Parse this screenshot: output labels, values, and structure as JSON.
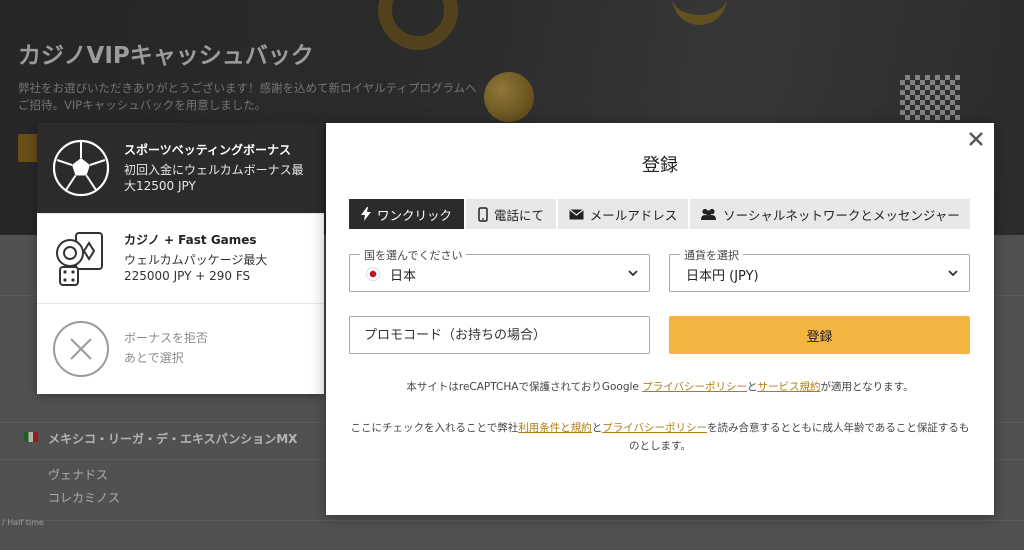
{
  "background": {
    "hero_title": "カジノVIPキャッシュバック",
    "hero_desc": "弊社をお選びいただきありがとうございます！感謝を込めて新ロイヤルティプログラムへご招待。VIPキャッシュバックを用意しました。",
    "league_name": "メキシコ・リーガ・デ・エキスパンションMX",
    "team_1": "ヴェナドス",
    "team_2": "コレカミノス",
    "half_time_label": "/ Half time"
  },
  "bonus_panel": {
    "items": [
      {
        "title": "スポーツベッティングボーナス",
        "desc": "初回入金にウェルカムボーナス最大12500 JPY",
        "icon": "soccer-ball-icon",
        "state": "selected"
      },
      {
        "title": "カジノ + Fast Games",
        "desc": "ウェルカムパッケージ最大225000 JPY + 290 FS",
        "icon": "casino-cards-icon",
        "state": "default"
      },
      {
        "title": "ボーナスを拒否",
        "desc": "あとで選択",
        "icon": "decline-x-icon",
        "state": "muted"
      }
    ]
  },
  "modal": {
    "title": "登録",
    "close_icon": "close-icon",
    "tabs": [
      {
        "label": "ワンクリック",
        "icon": "lightning-icon",
        "active": true
      },
      {
        "label": "電話にて",
        "icon": "phone-icon",
        "active": false
      },
      {
        "label": "メールアドレス",
        "icon": "envelope-icon",
        "active": false
      },
      {
        "label": "ソーシャルネットワークとメッセンジャー",
        "icon": "users-icon",
        "active": false
      }
    ],
    "country": {
      "label": "国を選んでください",
      "value": "日本"
    },
    "currency": {
      "label": "通貨を選択",
      "value": "日本円 (JPY)"
    },
    "promo_placeholder": "プロモコード（お持ちの場合）",
    "submit_label": "登録",
    "recaptcha": {
      "prefix": "本サイトはreCAPTCHAで保護されておりGoogle ",
      "privacy_link": "プライバシーポリシー",
      "and": "と",
      "terms_link": "サービス規約",
      "suffix": "が適用となります。"
    },
    "agreement": {
      "prefix": "ここにチェックを入れることで弊社",
      "terms_link": "利用条件と規約",
      "and": "と",
      "privacy_link": "プライバシーポリシー",
      "suffix": "を読み合意するとともに成人年齢であること保証するものとします。"
    }
  },
  "colors": {
    "accent": "#f3b53f",
    "dark": "#2b2b2b",
    "link": "#b07d10"
  }
}
